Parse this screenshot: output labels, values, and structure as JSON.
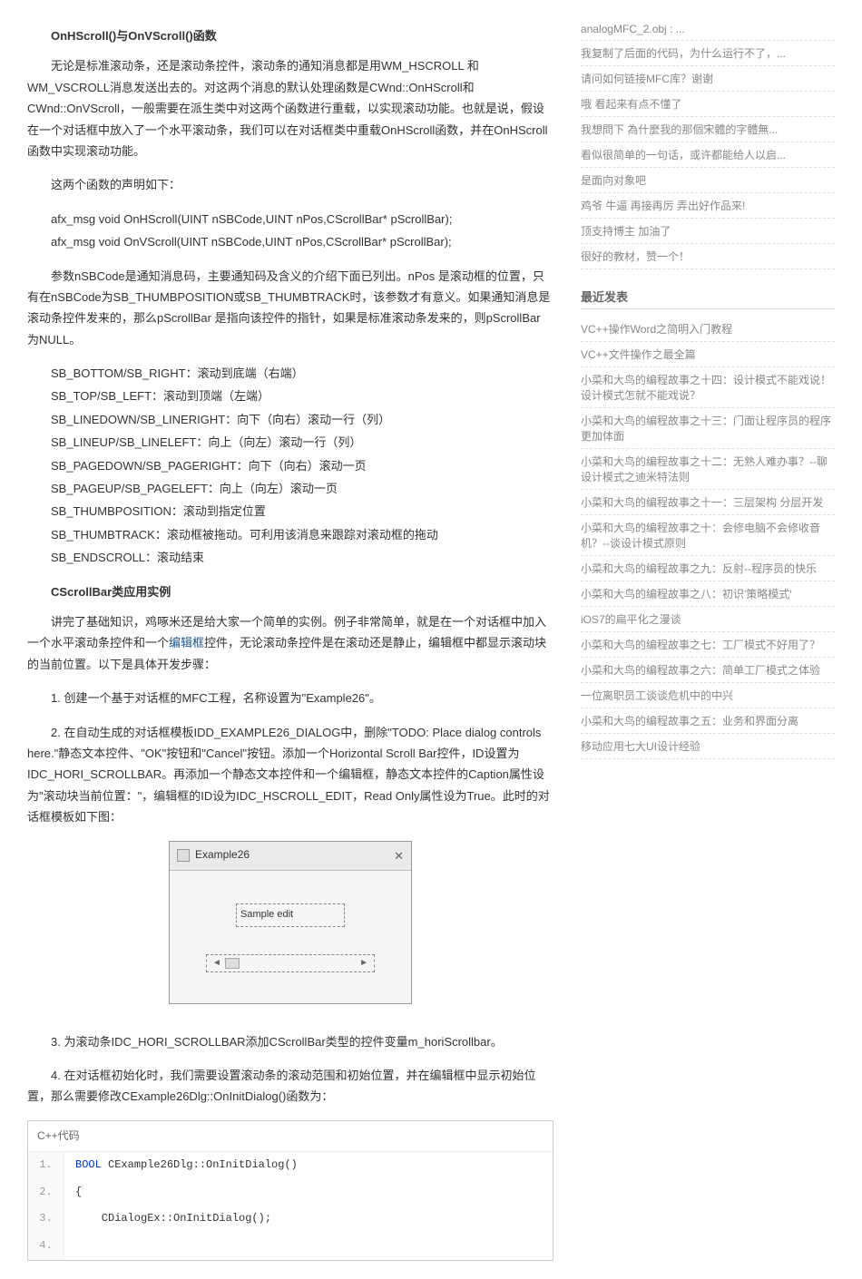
{
  "main": {
    "heading1": "OnHScroll()与OnVScroll()函数",
    "p1": "无论是标准滚动条，还是滚动条控件，滚动条的通知消息都是用WM_HSCROLL 和WM_VSCROLL消息发送出去的。对这两个消息的默认处理函数是CWnd::OnHScroll和CWnd::OnVScroll，一般需要在派生类中对这两个函数进行重载，以实现滚动功能。也就是说，假设在一个对话框中放入了一个水平滚动条，我们可以在对话框类中重载OnHScroll函数，并在OnHScroll函数中实现滚动功能。",
    "p2": "这两个函数的声明如下：",
    "sig1": "afx_msg void OnHScroll(UINT nSBCode,UINT nPos,CScrollBar* pScrollBar);",
    "sig2": "afx_msg void OnVScroll(UINT nSBCode,UINT nPos,CScrollBar* pScrollBar);",
    "p3": "参数nSBCode是通知消息码，主要通知码及含义的介绍下面已列出。nPos 是滚动框的位置，只有在nSBCode为SB_THUMBPOSITION或SB_THUMBTRACK时，该参数才有意义。如果通知消息是滚动条控件发来的，那么pScrollBar 是指向该控件的指针，如果是标准滚动条发来的，则pScrollBar 为NULL。",
    "c1": "SB_BOTTOM/SB_RIGHT：滚动到底端（右端）",
    "c2": "SB_TOP/SB_LEFT：滚动到顶端（左端）",
    "c3": "SB_LINEDOWN/SB_LINERIGHT：向下（向右）滚动一行（列）",
    "c4": "SB_LINEUP/SB_LINELEFT：向上（向左）滚动一行（列）",
    "c5": "SB_PAGEDOWN/SB_PAGERIGHT：向下（向右）滚动一页",
    "c6": "SB_PAGEUP/SB_PAGELEFT：向上（向左）滚动一页",
    "c7": "SB_THUMBPOSITION：滚动到指定位置",
    "c8": "SB_THUMBTRACK：滚动框被拖动。可利用该消息来跟踪对滚动框的拖动",
    "c9": "SB_ENDSCROLL：滚动结束",
    "heading2": "CScrollBar类应用实例",
    "p4a": "讲完了基础知识，鸡啄米还是给大家一个简单的实例。例子非常简单，就是在一个对话框中加入一个水平滚动条控件和一个",
    "link_edit": "编辑框",
    "p4b": "控件，无论滚动条控件是在滚动还是静止，编辑框中都显示滚动块的当前位置。以下是具体开发步骤：",
    "step1": "1. 创建一个基于对话框的MFC工程，名称设置为\"Example26\"。",
    "step2": "2. 在自动生成的对话框模板IDD_EXAMPLE26_DIALOG中，删除\"TODO: Place dialog controls here.\"静态文本控件、\"OK\"按钮和\"Cancel\"按钮。添加一个Horizontal Scroll Bar控件，ID设置为IDC_HORI_SCROLLBAR。再添加一个静态文本控件和一个编辑框，静态文本控件的Caption属性设为\"滚动块当前位置：\"，编辑框的ID设为IDC_HSCROLL_EDIT，Read Only属性设为True。此时的对话框模板如下图：",
    "dialog_title": "Example26",
    "dialog_sample": "Sample edit",
    "step3": "3. 为滚动条IDC_HORI_SCROLLBAR添加CScrollBar类型的控件变量m_horiScrollbar。",
    "step4": "4. 在对话框初始化时，我们需要设置滚动条的滚动范围和初始位置，并在编辑框中显示初始位置，那么需要修改CExample26Dlg::OnInitDialog()函数为：",
    "code_header": "C++代码",
    "code": {
      "l1": "BOOL CExample26Dlg::OnInitDialog()",
      "l2": "{",
      "l3": "    CDialogEx::OnInitDialog();",
      "l4": ""
    }
  },
  "sidebar": {
    "list1": [
      "analogMFC_2.obj : ...",
      "我复制了后面的代码，为什么运行不了，...",
      "请问如何链接MFC库？谢谢",
      "哦 看起来有点不懂了",
      "我想問下 為什麼我的那個宋體的字體無...",
      "看似很简单的一句话，或许都能给人以启...",
      "是面向对象吧",
      "鸡爷 牛逼 再接再厉 弄出好作品来!",
      "顶支持博主 加油了",
      "很好的教材，赞一个！"
    ],
    "title2": "最近发表",
    "list2": [
      "VC++操作Word之简明入门教程",
      "VC++文件操作之最全篇",
      "小菜和大鸟的编程故事之十四：设计模式不能戏说！设计模式怎就不能戏说？",
      "小菜和大鸟的编程故事之十三：门面让程序员的程序更加体面",
      "小菜和大鸟的编程故事之十二：无熟人难办事？--聊设计模式之迪米特法则",
      "小菜和大鸟的编程故事之十一：三层架构 分层开发",
      "小菜和大鸟的编程故事之十：会修电脑不会修收音机？--谈设计模式原则",
      "小菜和大鸟的编程故事之九：反射--程序员的快乐",
      "小菜和大鸟的编程故事之八：初识'策略模式'",
      "iOS7的扁平化之漫谈",
      "小菜和大鸟的编程故事之七：工厂模式不好用了？",
      "小菜和大鸟的编程故事之六：简单工厂模式之体验",
      "一位离职员工谈谈危机中的中兴",
      "小菜和大鸟的编程故事之五：业务和界面分离",
      "移动应用七大UI设计经验"
    ]
  }
}
